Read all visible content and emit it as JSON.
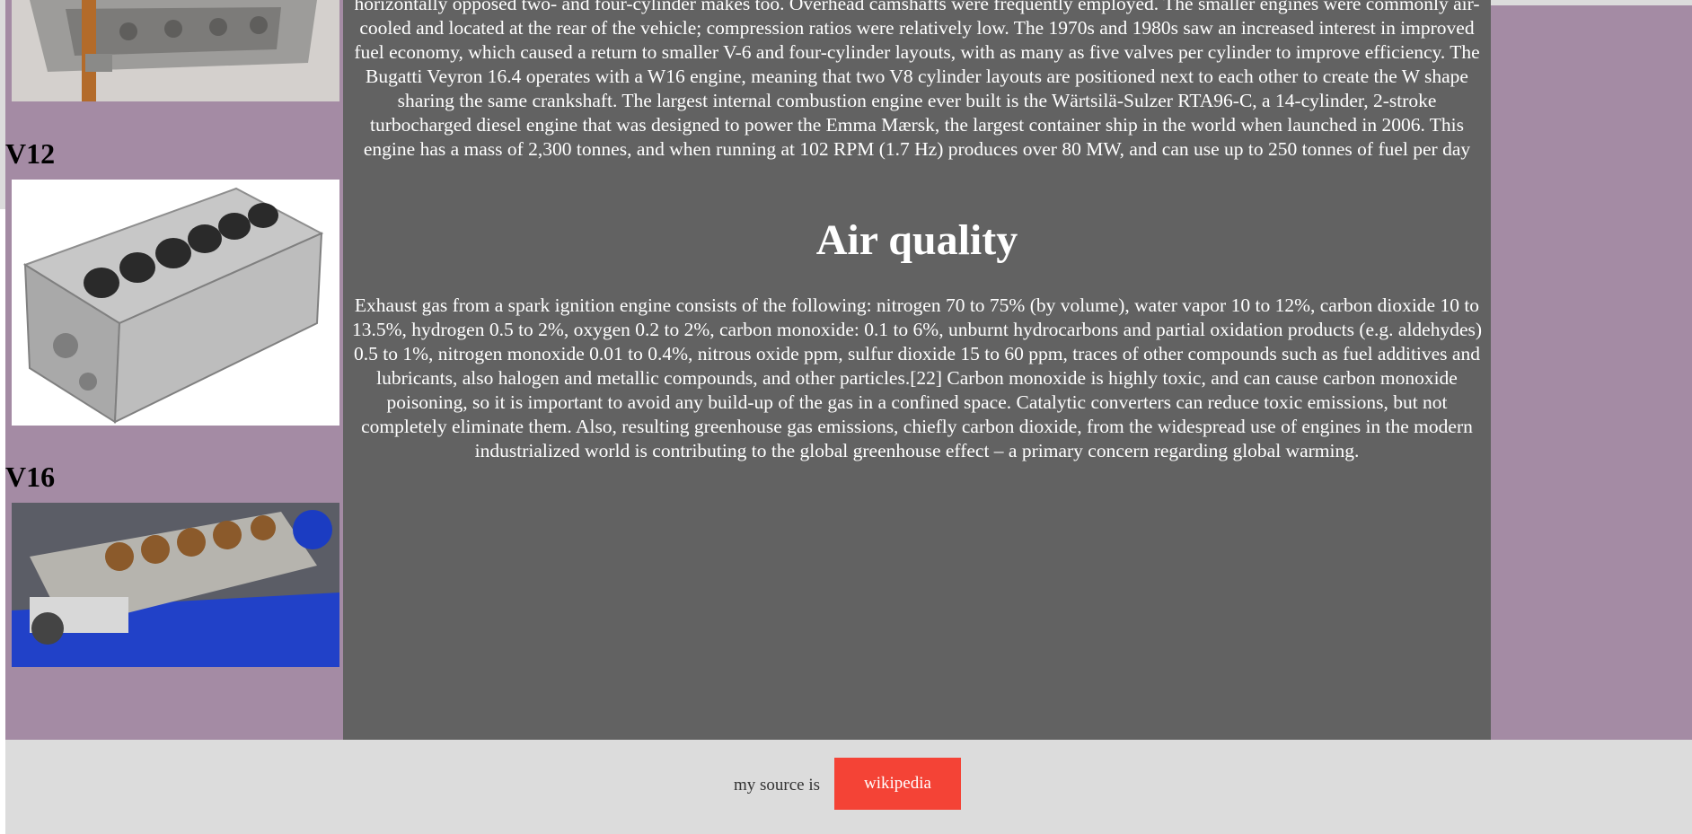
{
  "sidebar": {
    "engines": [
      {
        "title": "V12",
        "image_icon": "v12-engine-block-image"
      },
      {
        "title": "V16",
        "image_icon": "v16-engine-image"
      }
    ],
    "top_image_icon": "engine-block-image"
  },
  "main": {
    "intro_paragraph": "horizontally opposed two- and four-cylinder makes too. Overhead camshafts were frequently employed. The smaller engines were commonly air-cooled and located at the rear of the vehicle; compression ratios were relatively low. The 1970s and 1980s saw an increased interest in improved fuel economy, which caused a return to smaller V-6 and four-cylinder layouts, with as many as five valves per cylinder to improve efficiency. The Bugatti Veyron 16.4 operates with a W16 engine, meaning that two V8 cylinder layouts are positioned next to each other to create the W shape sharing the same crankshaft. The largest internal combustion engine ever built is the Wärtsilä-Sulzer RTA96-C, a 14-cylinder, 2-stroke turbocharged diesel engine that was designed to power the Emma Mærsk, the largest container ship in the world when launched in 2006. This engine has a mass of 2,300 tonnes, and when running at 102 RPM (1.7 Hz) produces over 80 MW, and can use up to 250 tonnes of fuel per day",
    "air_quality_heading": "Air quality",
    "air_quality_paragraph": "Exhaust gas from a spark ignition engine consists of the following: nitrogen 70 to 75% (by volume), water vapor 10 to 12%, carbon dioxide 10 to 13.5%, hydrogen 0.5 to 2%, oxygen 0.2 to 2%, carbon monoxide: 0.1 to 6%, unburnt hydrocarbons and partial oxidation products (e.g. aldehydes) 0.5 to 1%, nitrogen monoxide 0.01 to 0.4%, nitrous oxide ppm, sulfur dioxide 15 to 60 ppm, traces of other compounds such as fuel additives and lubricants, also halogen and metallic compounds, and other particles.[22] Carbon monoxide is highly toxic, and can cause carbon monoxide poisoning, so it is important to avoid any build-up of the gas in a confined space. Catalytic converters can reduce toxic emissions, but not completely eliminate them. Also, resulting greenhouse gas emissions, chiefly carbon dioxide, from the widespread use of engines in the modern industrialized world is contributing to the global greenhouse effect – a primary concern regarding global warming."
  },
  "footer": {
    "source_label": "my source is",
    "source_button": "wikipedia"
  },
  "colors": {
    "sidebar_bg": "#a48ba4",
    "main_bg": "#626262",
    "footer_bg": "#dcdcdc",
    "button_bg": "#f44336"
  }
}
